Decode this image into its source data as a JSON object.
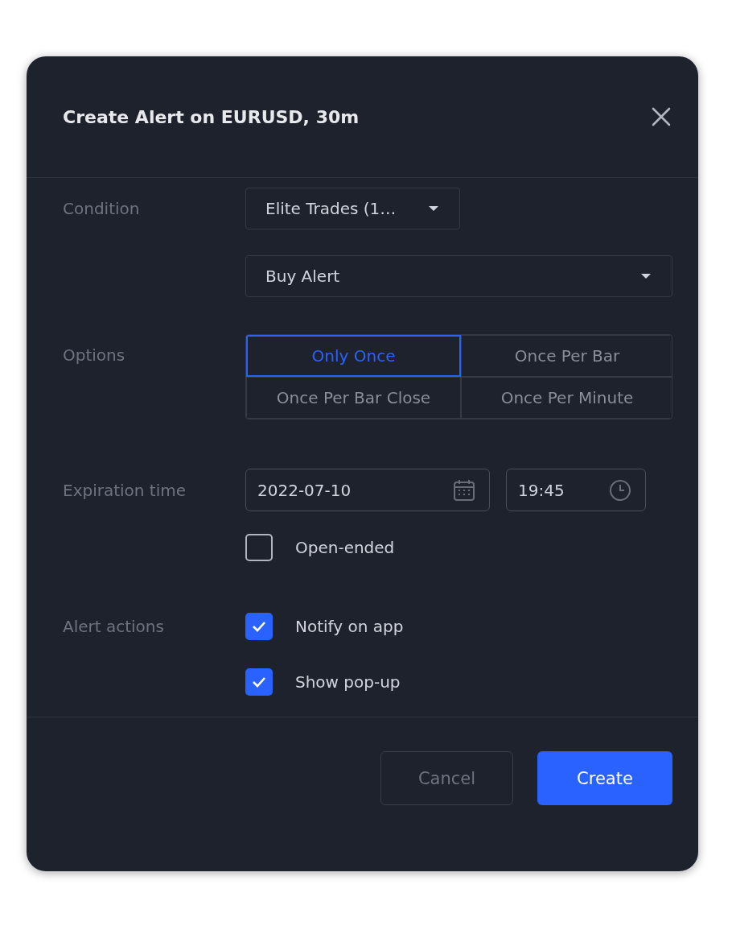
{
  "dialog": {
    "title": "Create Alert on EURUSD, 30m"
  },
  "condition": {
    "label": "Condition",
    "indicator": "Elite Trades (1…",
    "signal": "Buy Alert"
  },
  "options": {
    "label": "Options",
    "items": [
      {
        "label": "Only Once",
        "selected": true
      },
      {
        "label": "Once Per Bar",
        "selected": false
      },
      {
        "label": "Once Per Bar Close",
        "selected": false
      },
      {
        "label": "Once Per Minute",
        "selected": false
      }
    ]
  },
  "expiration": {
    "label": "Expiration time",
    "date": "2022-07-10",
    "time": "19:45",
    "open_ended": {
      "label": "Open-ended",
      "checked": false
    }
  },
  "alert_actions": {
    "label": "Alert actions",
    "items": [
      {
        "label": "Notify on app",
        "checked": true
      },
      {
        "label": "Show pop-up",
        "checked": true
      }
    ]
  },
  "buttons": [
    {
      "label": "Cancel",
      "kind": "secondary"
    },
    {
      "label": "Create",
      "kind": "primary"
    }
  ]
}
